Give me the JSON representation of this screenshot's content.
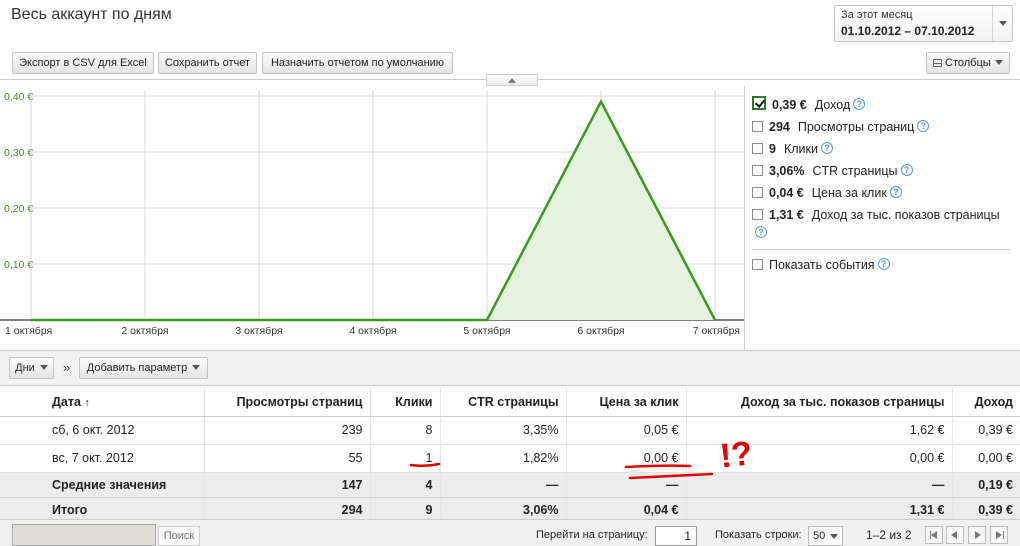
{
  "header": {
    "title": "Весь аккаунт по дням",
    "date_label": "За этот месяц",
    "date_range": "01.10.2012 – 07.10.2012"
  },
  "toolbar": {
    "export_label": "Экспорт в CSV для Excel",
    "save_label": "Сохранить отчет",
    "default_label": "Назначить отчетом по умолчанию",
    "columns_label": "Столбцы"
  },
  "chart_data": {
    "type": "area",
    "x": [
      "1 октября",
      "2 октября",
      "3 октября",
      "4 октября",
      "5 октября",
      "6 октября",
      "7 октября"
    ],
    "series": [
      {
        "name": "Доход",
        "values": [
          0,
          0,
          0,
          0,
          0,
          0.39,
          0
        ]
      }
    ],
    "y_ticks": [
      "0,10 €",
      "0,20 €",
      "0,30 €",
      "0,40 €"
    ],
    "ylim": [
      0,
      0.4
    ],
    "grid": true,
    "colors": {
      "line": "#3a9a1f",
      "fill": "#e6f2e0",
      "tick": "#4a8a1a"
    }
  },
  "metrics": [
    {
      "value": "0,39 €",
      "label": "Доход",
      "checked": true
    },
    {
      "value": "294",
      "label": "Просмотры страниц",
      "checked": false
    },
    {
      "value": "9",
      "label": "Клики",
      "checked": false
    },
    {
      "value": "3,06%",
      "label": "CTR страницы",
      "checked": false
    },
    {
      "value": "0,04 €",
      "label": "Цена за клик",
      "checked": false
    },
    {
      "value": "1,31 €",
      "label": "Доход за тыс. показов страницы",
      "checked": false
    }
  ],
  "events_label": "Показать события",
  "table_toolbar": {
    "days_label": "Дни",
    "separator": "»",
    "add_param_label": "Добавить параметр"
  },
  "table": {
    "columns": [
      "Дата",
      "Просмотры страниц",
      "Клики",
      "CTR страницы",
      "Цена за клик",
      "Доход за тыс. показов страницы",
      "Доход"
    ],
    "rows": [
      [
        "сб, 6 окт. 2012",
        "239",
        "8",
        "3,35%",
        "0,05 €",
        "1,62 €",
        "0,39 €"
      ],
      [
        "вс, 7 окт. 2012",
        "55",
        "1",
        "1,82%",
        "0,00 €",
        "0,00 €",
        "0,00 €"
      ]
    ],
    "averages": [
      "Средние значения",
      "147",
      "4",
      "—",
      "—",
      "—",
      "0,19 €"
    ],
    "totals": [
      "Итого",
      "294",
      "9",
      "3,06%",
      "0,04 €",
      "1,31 €",
      "0,39 €"
    ]
  },
  "footer": {
    "search_label": "Поиск",
    "goto_label": "Перейти на страницу:",
    "goto_value": "1",
    "rows_label": "Показать строки:",
    "rows_value": "50",
    "pager_info": "1–2 из 2"
  },
  "annotation": {
    "text": "!?",
    "color": "#e00000"
  }
}
